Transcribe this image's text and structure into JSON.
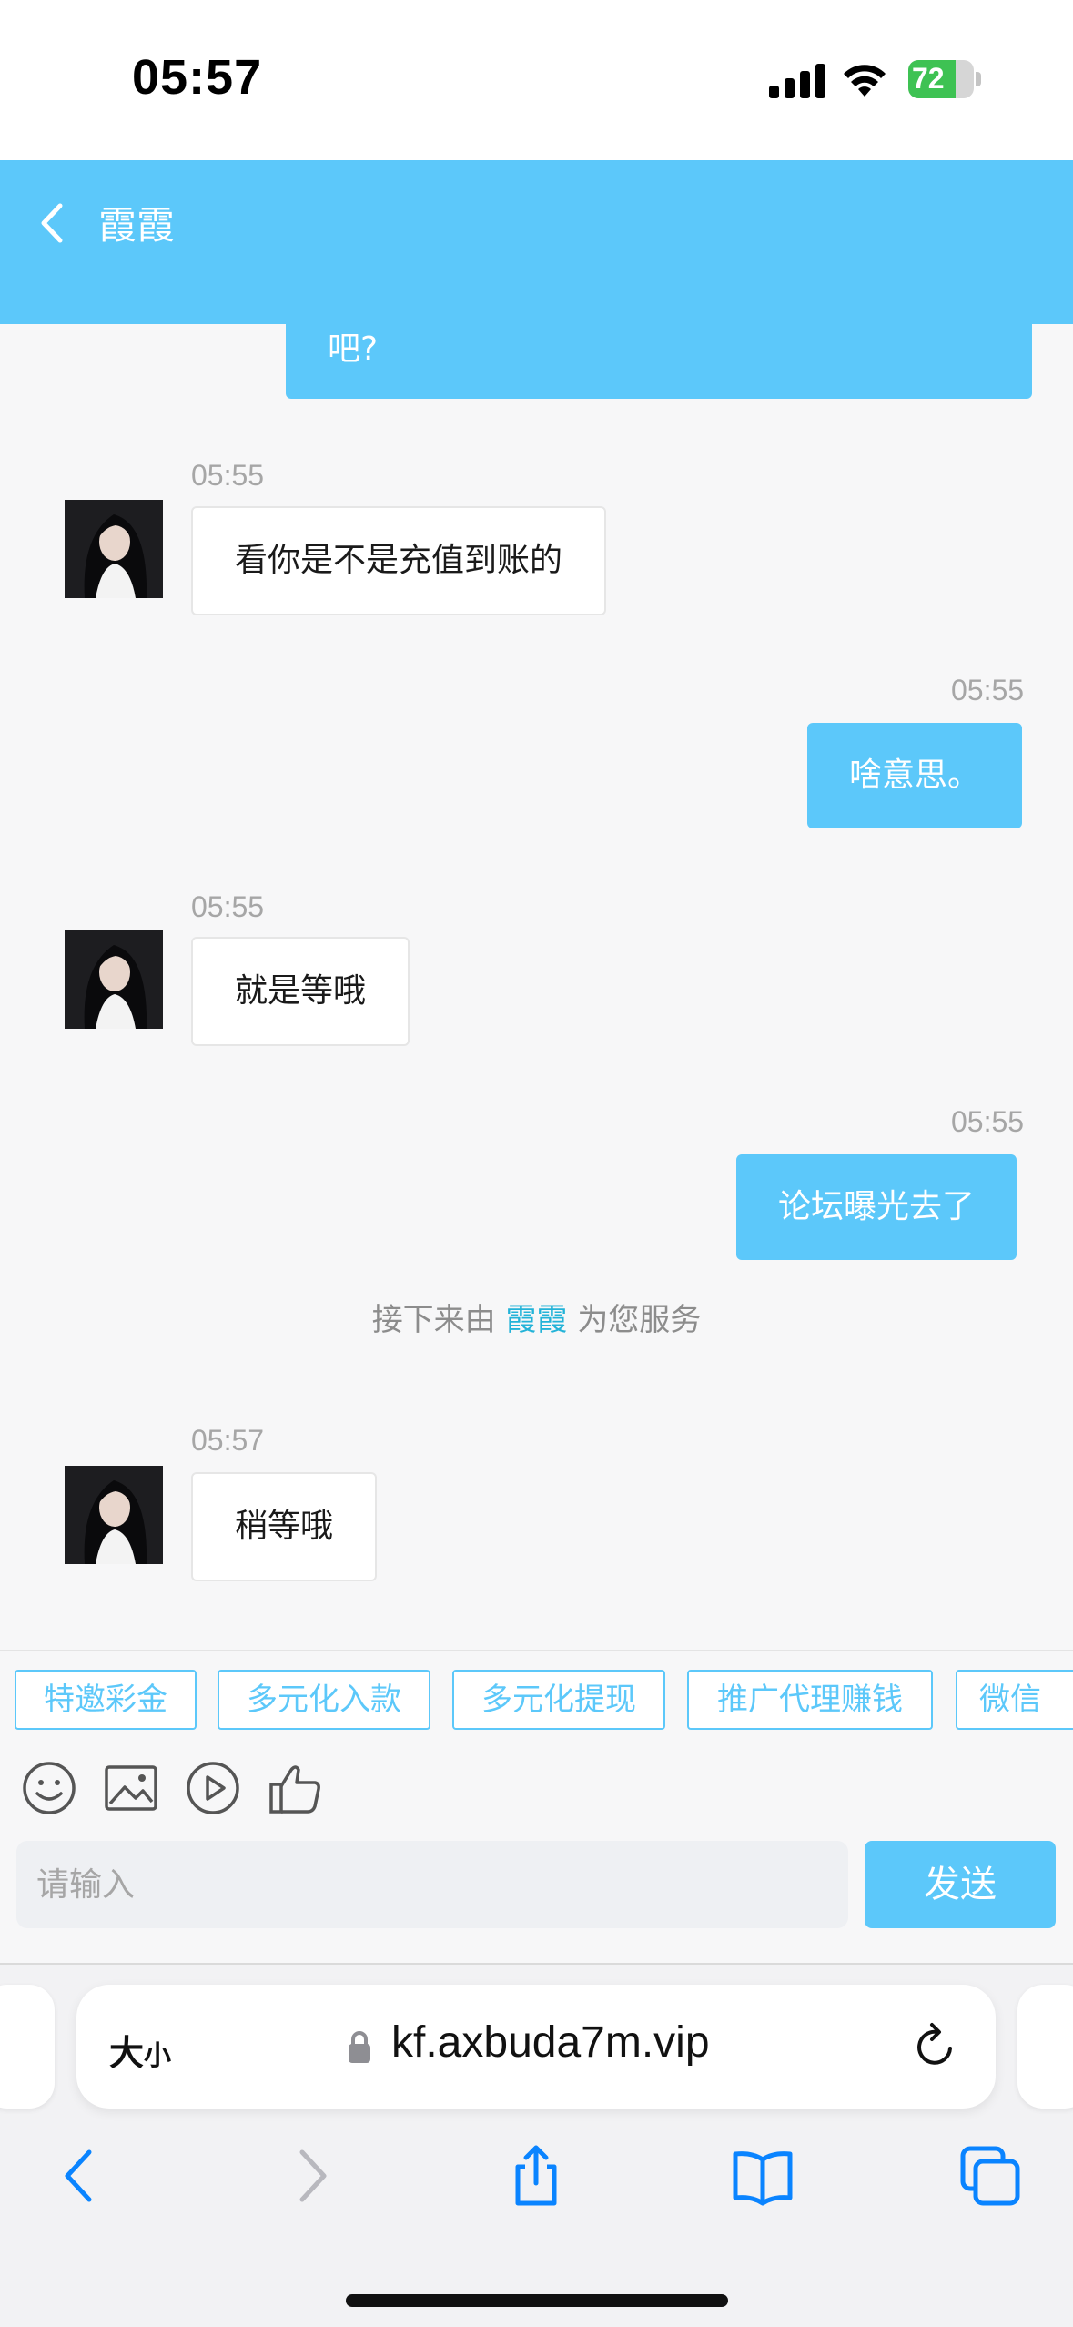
{
  "status_bar": {
    "time": "05:57",
    "battery": "72",
    "battery_level": 0.72
  },
  "header": {
    "title": "霞霞"
  },
  "chat": {
    "partial_message": "吧?",
    "messages": [
      {
        "dir": "in",
        "time": "05:55",
        "text": "看你是不是充值到账的"
      },
      {
        "dir": "out",
        "time": "05:55",
        "text": "啥意思。"
      },
      {
        "dir": "in",
        "time": "05:55",
        "text": "就是等哦"
      },
      {
        "dir": "out",
        "time": "05:55",
        "text": "论坛曝光去了"
      },
      {
        "dir": "in",
        "time": "05:57",
        "text": "稍等哦"
      }
    ],
    "system_note": {
      "prefix": "接下来由",
      "name": "霞霞",
      "suffix": "为您服务"
    }
  },
  "quick_replies": [
    "特邀彩金",
    "多元化入款",
    "多元化提现",
    "推广代理赚钱",
    "微信"
  ],
  "toolbar": {
    "icons": [
      "emoji-icon",
      "image-icon",
      "video-icon",
      "thumbs-up-icon"
    ]
  },
  "input": {
    "placeholder": "请输入",
    "send_label": "发送"
  },
  "browser": {
    "text_size_label": "大",
    "text_size_small": "小",
    "url": "kf.axbuda7m.vip"
  },
  "colors": {
    "accent": "#5cc8fa",
    "system_name": "#23b3d8",
    "ios_blue": "#0a84ff"
  }
}
